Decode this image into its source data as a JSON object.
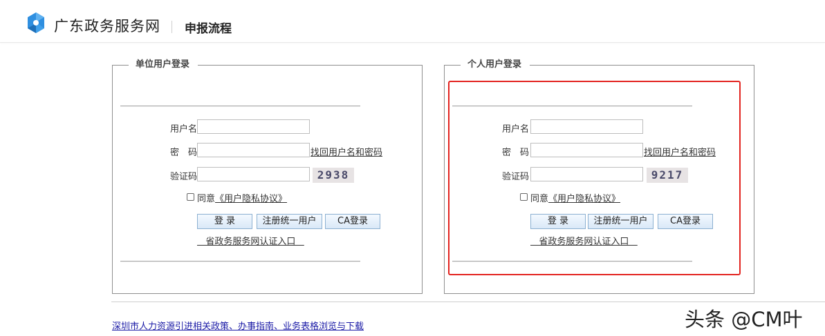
{
  "header": {
    "site_title": "广东政务服务网",
    "subtitle": "申报流程"
  },
  "panels": {
    "org": {
      "legend": "单位用户登录",
      "username_label": "用户名",
      "password_label": "密　码",
      "forgot_link": "找回用户名和密码",
      "captcha_label": "验证码",
      "captcha_code": "2938",
      "agree_prefix": "同意",
      "agree_link": "《用户隐私协议》",
      "login_button": "登 录",
      "register_button": "注册统一用户",
      "ca_button": "CA登录",
      "portal_link": "   省政务服务网认证入口   "
    },
    "personal": {
      "legend": "个人用户登录",
      "username_label": "用户名",
      "password_label": "密　码",
      "forgot_link": "找回用户名和密码",
      "captcha_label": "验证码",
      "captcha_code": "9217",
      "agree_prefix": "同意",
      "agree_link": "《用户隐私协议》",
      "login_button": "登 录",
      "register_button": "注册统一用户",
      "ca_button": "CA登录",
      "portal_link": "   省政务服务网认证入口   "
    }
  },
  "footer": {
    "link": "深圳市人力资源引进相关政策、办事指南、业务表格浏览与下载"
  },
  "watermark": "头条 @CM叶",
  "colors": {
    "highlight_frame": "#e3231f",
    "logo_blue": "#2f8fe0",
    "footer_link": "#1a1aa6"
  },
  "icons": {
    "logo": "gd-gov-service-logo-icon"
  }
}
